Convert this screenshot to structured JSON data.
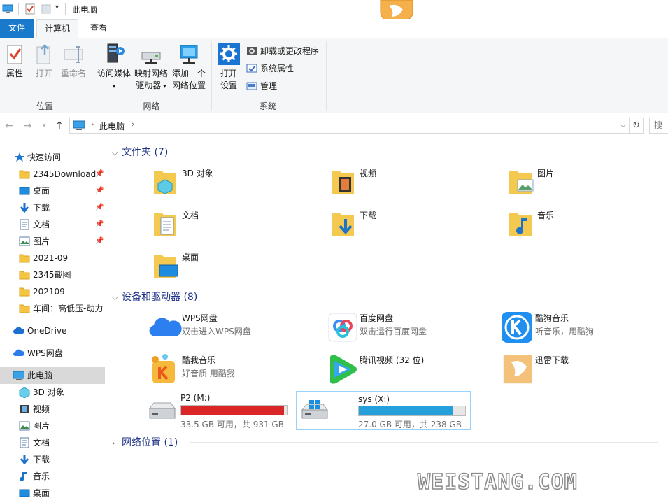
{
  "titlebar": {
    "title": "此电脑"
  },
  "ribbon_tabs": {
    "file": "文件",
    "computer": "计算机",
    "view": "查看"
  },
  "ribbon": {
    "location": {
      "label": "位置",
      "properties": "属性",
      "open": "打开",
      "rename": "重命名"
    },
    "network": {
      "label": "网络",
      "access_media_1": "访问媒体",
      "map_drive_1": "映射网络",
      "map_drive_2": "驱动器",
      "add_location_1": "添加一个",
      "add_location_2": "网络位置"
    },
    "system": {
      "label": "系统",
      "open_settings_1": "打开",
      "open_settings_2": "设置",
      "uninstall": "卸载或更改程序",
      "sys_props": "系统属性",
      "manage": "管理"
    }
  },
  "address": {
    "path": "此电脑",
    "search_placeholder": "搜"
  },
  "sidebar": {
    "items": [
      {
        "label": "快速访问",
        "icon": "star-icon"
      },
      {
        "label": "2345Download",
        "icon": "folder-icon",
        "pinned": true
      },
      {
        "label": "桌面",
        "icon": "desktop-icon",
        "pinned": true
      },
      {
        "label": "下载",
        "icon": "download-icon",
        "pinned": true
      },
      {
        "label": "文档",
        "icon": "document-icon",
        "pinned": true
      },
      {
        "label": "图片",
        "icon": "pictures-icon",
        "pinned": true
      },
      {
        "label": "2021-09",
        "icon": "folder-icon"
      },
      {
        "label": "2345截图",
        "icon": "folder-icon"
      },
      {
        "label": "202109",
        "icon": "folder-icon"
      },
      {
        "label": "车间：高低压-动力",
        "icon": "folder-icon"
      },
      {
        "label": "OneDrive",
        "icon": "cloud-icon"
      },
      {
        "label": "WPS网盘",
        "icon": "wps-cloud-icon"
      },
      {
        "label": "此电脑",
        "icon": "computer-icon"
      },
      {
        "label": "3D 对象",
        "icon": "3d-objects-icon"
      },
      {
        "label": "视频",
        "icon": "video-icon"
      },
      {
        "label": "图片",
        "icon": "pictures-icon"
      },
      {
        "label": "文档",
        "icon": "document-icon"
      },
      {
        "label": "下载",
        "icon": "download-icon"
      },
      {
        "label": "音乐",
        "icon": "music-icon"
      },
      {
        "label": "桌面",
        "icon": "desktop-icon"
      }
    ]
  },
  "sections": {
    "folders": "文件夹 (7)",
    "devices": "设备和驱动器 (8)",
    "network": "网络位置 (1)"
  },
  "folders": [
    {
      "name": "3D 对象"
    },
    {
      "name": "视频"
    },
    {
      "name": "图片"
    },
    {
      "name": "文档"
    },
    {
      "name": "下载"
    },
    {
      "name": "音乐"
    },
    {
      "name": "桌面"
    }
  ],
  "devices": [
    {
      "name": "WPS网盘",
      "sub": "双击进入WPS网盘"
    },
    {
      "name": "百度网盘",
      "sub": "双击运行百度网盘"
    },
    {
      "name": "酷狗音乐",
      "sub": "听音乐，用酷狗"
    },
    {
      "name": "酷我音乐",
      "sub": "好音质 用酷我"
    },
    {
      "name": "腾讯视频 (32 位)",
      "sub": ""
    },
    {
      "name": "迅雷下载",
      "sub": ""
    }
  ],
  "drives": [
    {
      "name": "P2 (M:)",
      "info": "33.5 GB 可用，共 931 GB",
      "used_fraction": 0.964,
      "color": "#da2626"
    },
    {
      "name": "sys (X:)",
      "info": "27.0 GB 可用，共 238 GB",
      "used_fraction": 0.887,
      "color": "#26a0da"
    }
  ],
  "watermark": "WEISTANG.COM"
}
